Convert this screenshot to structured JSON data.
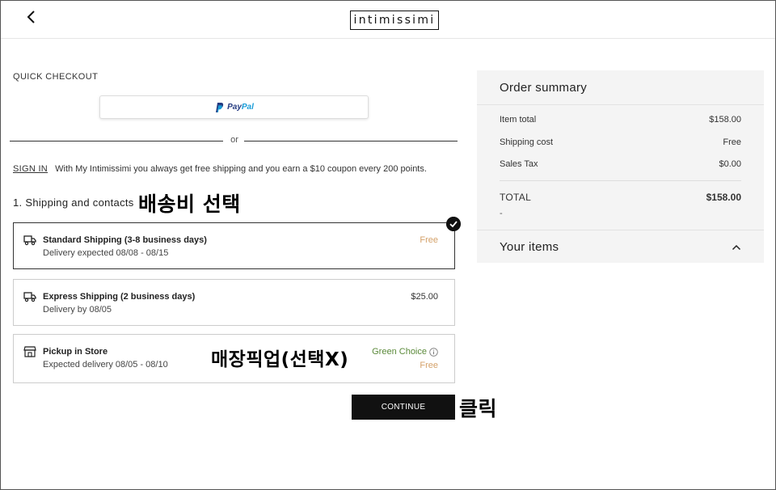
{
  "header": {
    "logo_text": "intimissimi",
    "back_icon": "chevron-left-icon"
  },
  "quick_checkout": {
    "label": "QUICK CHECKOUT",
    "paypal": {
      "brand_part1": "Pay",
      "brand_part2": "Pal",
      "brand_colors": [
        "#253b80",
        "#179bd7"
      ]
    },
    "divider_text": "or"
  },
  "sign_in": {
    "link": "SIGN IN",
    "message": "With My Intimissimi you always get free shipping and you earn a $10 coupon every 200 points."
  },
  "shipping": {
    "section_title": "1. Shipping and contacts",
    "annotation": "배송비 선택",
    "options": [
      {
        "title": "Standard Shipping (3-8 business days)",
        "subtitle": "Delivery expected 08/08 - 08/15",
        "price": "Free",
        "selected": true,
        "icon": "truck-icon"
      },
      {
        "title": "Express Shipping (2 business days)",
        "subtitle": "Delivery by 08/05",
        "price": "$25.00",
        "selected": false,
        "icon": "truck-icon"
      },
      {
        "title": "Pickup in Store",
        "subtitle": "Expected delivery 08/05 - 08/10",
        "badge": "Green Choice",
        "price": "Free",
        "selected": false,
        "icon": "store-icon",
        "annotation": "매장픽업(선택X)"
      }
    ]
  },
  "continue": {
    "label": "CONTINUE",
    "annotation": "클릭"
  },
  "summary": {
    "title": "Order summary",
    "rows": [
      {
        "label": "Item total",
        "value": "$158.00"
      },
      {
        "label": "Shipping cost",
        "value": "Free"
      },
      {
        "label": "Sales Tax",
        "value": "$0.00"
      }
    ],
    "total_label": "TOTAL",
    "total_value": "$158.00",
    "total_note": "-",
    "items_label": "Your items"
  },
  "colors": {
    "free_price": "#d4a26a",
    "green_choice": "#5b8a3a",
    "summary_bg": "#f4f4f4",
    "button_bg": "#111111"
  }
}
